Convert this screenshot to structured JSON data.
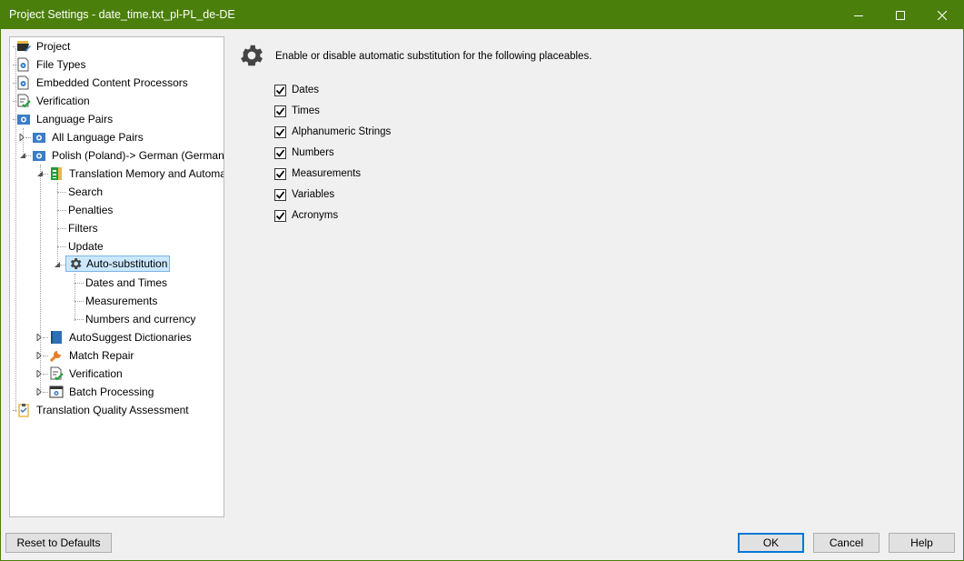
{
  "window": {
    "title": "Project Settings - date_time.txt_pl-PL_de-DE",
    "controls": [
      "minimize",
      "maximize",
      "close"
    ]
  },
  "tree": {
    "items": [
      {
        "label": "Project",
        "icon": "project-folder-icon"
      },
      {
        "label": "File Types",
        "icon": "file-types-icon"
      },
      {
        "label": "Embedded Content Processors",
        "icon": "embedded-content-icon"
      },
      {
        "label": "Verification",
        "icon": "verification-icon"
      },
      {
        "label": "Language Pairs",
        "icon": "language-pairs-icon"
      },
      {
        "label": "All Language Pairs",
        "icon": "language-pair-icon"
      },
      {
        "label": "Polish (Poland)-> German (Germany)",
        "icon": "language-pair-icon"
      },
      {
        "label": "Translation Memory and Automat",
        "icon": "translation-memory-icon"
      },
      {
        "label": "Search"
      },
      {
        "label": "Penalties"
      },
      {
        "label": "Filters"
      },
      {
        "label": "Update"
      },
      {
        "label": "Auto-substitution",
        "icon": "gear-icon",
        "selected": true
      },
      {
        "label": "Dates and Times"
      },
      {
        "label": "Measurements"
      },
      {
        "label": "Numbers and currency"
      },
      {
        "label": "AutoSuggest Dictionaries",
        "icon": "dictionary-icon"
      },
      {
        "label": "Match Repair",
        "icon": "wrench-icon"
      },
      {
        "label": "Verification",
        "icon": "verification-icon"
      },
      {
        "label": "Batch Processing",
        "icon": "batch-processing-icon"
      },
      {
        "label": "Translation Quality Assessment",
        "icon": "tqa-clipboard-icon"
      }
    ]
  },
  "panel": {
    "description": "Enable or disable automatic substitution for the following placeables.",
    "options": [
      {
        "label": "Dates",
        "checked": true
      },
      {
        "label": "Times",
        "checked": true
      },
      {
        "label": "Alphanumeric Strings",
        "checked": true
      },
      {
        "label": "Numbers",
        "checked": true
      },
      {
        "label": "Measurements",
        "checked": true
      },
      {
        "label": "Variables",
        "checked": true
      },
      {
        "label": "Acronyms",
        "checked": true
      }
    ]
  },
  "buttons": {
    "reset": "Reset to Defaults",
    "ok": "OK",
    "cancel": "Cancel",
    "help": "Help"
  },
  "colors": {
    "titlebar": "#4b7f0b",
    "selection": "#cce8ff",
    "default_button_border": "#0078d7"
  }
}
